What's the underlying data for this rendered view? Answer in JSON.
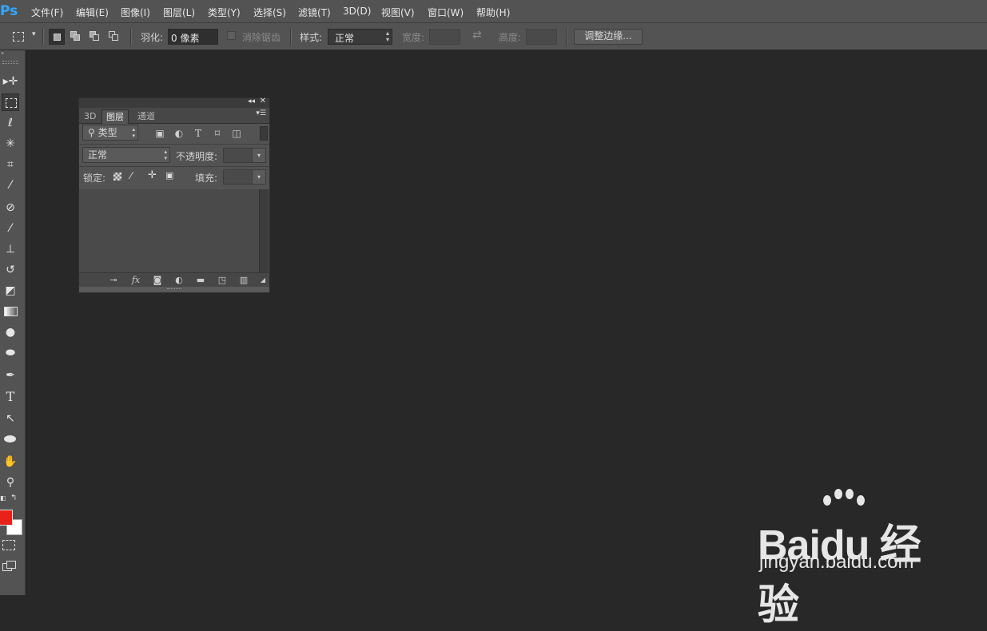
{
  "app": {
    "logo": "Ps",
    "accent": "#31a8ff"
  },
  "menu": [
    "文件(F)",
    "编辑(E)",
    "图像(I)",
    "图层(L)",
    "类型(Y)",
    "选择(S)",
    "滤镜(T)",
    "3D(D)",
    "视图(V)",
    "窗口(W)",
    "帮助(H)"
  ],
  "options": {
    "feather_label": "羽化:",
    "feather_value": "0 像素",
    "antialias_label": "消除锯齿",
    "style_label": "样式:",
    "style_value": "正常",
    "width_label": "宽度:",
    "height_label": "高度:",
    "refine_edge": "调整边缘..."
  },
  "layers_panel": {
    "tabs": [
      "3D",
      "图层",
      "通道"
    ],
    "active_tab": "图层",
    "filter_label": "类型",
    "blend_mode": "正常",
    "opacity_label": "不透明度:",
    "lock_label": "锁定:",
    "fill_label": "填充:"
  },
  "colors": {
    "foreground": "#e8221a",
    "background": "#ffffff"
  },
  "watermark": {
    "main": "Baidu 经验",
    "sub": "jingyan.baidu.com"
  }
}
